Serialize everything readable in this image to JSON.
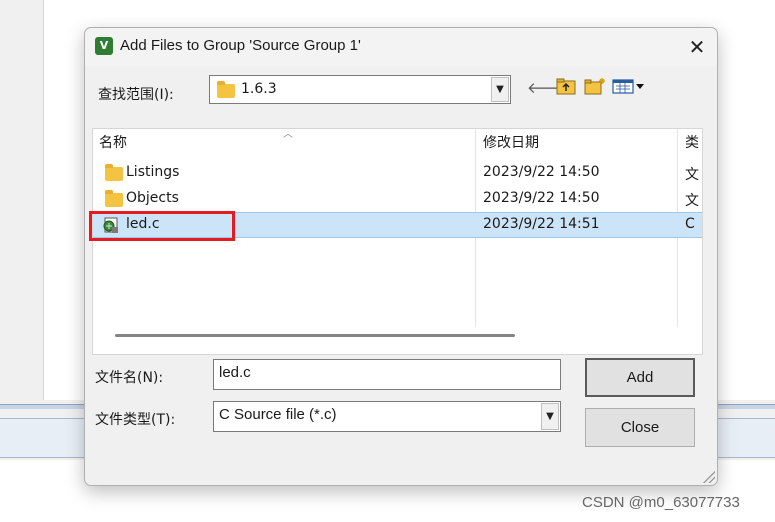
{
  "dialog": {
    "title": "Add Files to Group 'Source Group 1'",
    "close_glyph": "✕",
    "app_icon_letter": "V"
  },
  "lookin": {
    "label": "查找范围(I):",
    "value": "1.6.3"
  },
  "toolbar": {
    "back_icon": "back-arrow-icon",
    "up_icon": "up-folder-icon",
    "new_folder_icon": "new-folder-icon",
    "view_menu_icon": "view-menu-icon"
  },
  "list": {
    "headers": [
      "名称",
      "修改日期",
      "类"
    ],
    "rows": [
      {
        "name": "Listings",
        "date": "2023/9/22 14:50",
        "type": "文",
        "icon": "folder-icon",
        "selected": false
      },
      {
        "name": "Objects",
        "date": "2023/9/22 14:50",
        "type": "文",
        "icon": "folder-icon",
        "selected": false
      },
      {
        "name": "led.c",
        "date": "2023/9/22 14:51",
        "type": "C",
        "icon": "c-source-file-icon",
        "selected": true
      }
    ]
  },
  "filename": {
    "label": "文件名(N):",
    "value": "led.c"
  },
  "filetype": {
    "label": "文件类型(T):",
    "value": "C Source file (*.c)"
  },
  "buttons": {
    "add": "Add",
    "close": "Close"
  },
  "colors": {
    "selection": "#cce4f7",
    "highlight_box": "#e31b23"
  },
  "watermark": "CSDN @m0_63077733"
}
